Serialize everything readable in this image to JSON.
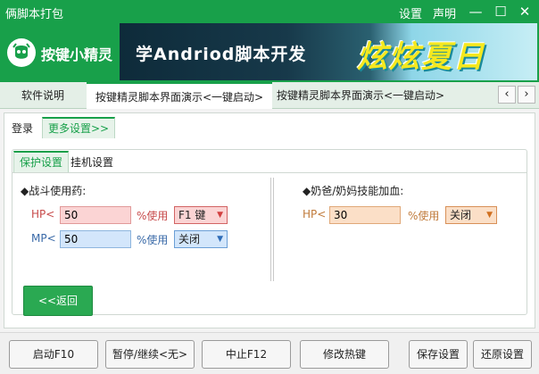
{
  "window": {
    "title": "俩脚本打包",
    "settings_link": "设置",
    "statement_link": "声明",
    "minimize": "—",
    "maximize": "☐",
    "close": "✕"
  },
  "header": {
    "logo_text": "按键小精灵",
    "banner_text": "学Andriod脚本开发",
    "banner_summer": "炫炫夏日"
  },
  "top_tabs": [
    {
      "label": "软件说明"
    },
    {
      "label": "按键精灵脚本界面演示<一键启动>"
    },
    {
      "label": "按键精灵脚本界面演示<一键启动>"
    }
  ],
  "nav": {
    "prev": "‹",
    "next": "›"
  },
  "main_tabs": [
    {
      "label": "登录"
    },
    {
      "label": "更多设置>>"
    }
  ],
  "sub_tabs": [
    {
      "label": "保护设置"
    },
    {
      "label": "挂机设置"
    }
  ],
  "battle": {
    "title": "◆战斗使用药:",
    "hp_label": "HP<",
    "hp_value": "50",
    "hp_use": "%使用",
    "hp_key": "F1 键",
    "mp_label": "MP<",
    "mp_value": "50",
    "mp_use": "%使用",
    "mp_key": "关闭"
  },
  "heal": {
    "title": "◆奶爸/奶妈技能加血:",
    "hp_label": "HP<",
    "hp_value": "30",
    "hp_use": "%使用",
    "hp_key": "关闭"
  },
  "back_button": "<<返回",
  "bottom_buttons": {
    "start": "启动F10",
    "pause": "暂停/继续<无>",
    "stop": "中止F12",
    "hotkey": "修改热键",
    "save": "保存设置",
    "restore": "还原设置"
  },
  "colors": {
    "brand_green": "#18a04a",
    "hp_red": "#c74a4a",
    "mp_blue": "#3a6aa8",
    "heal_orange": "#c07a3a"
  }
}
